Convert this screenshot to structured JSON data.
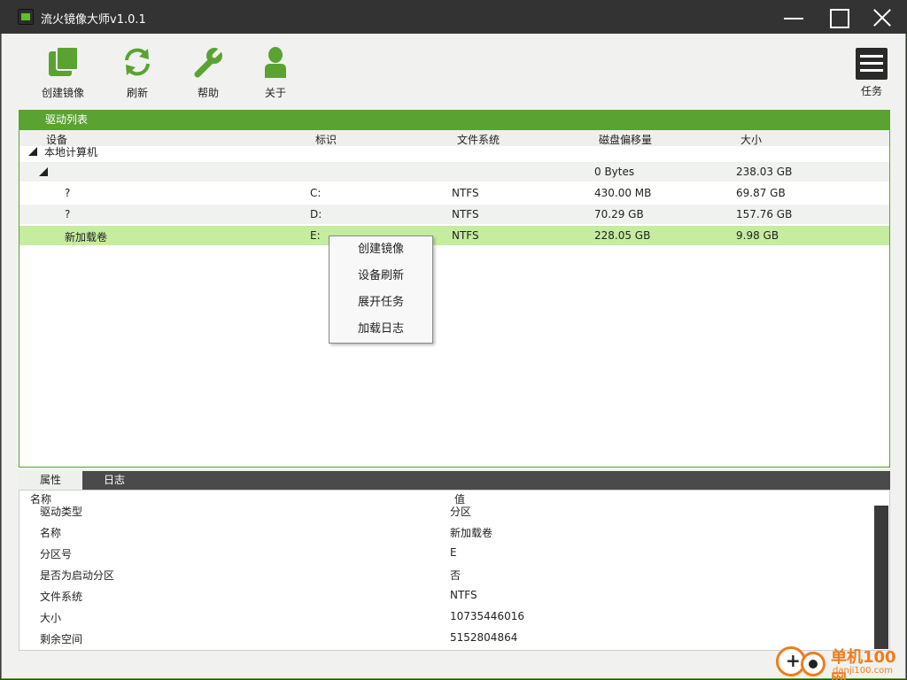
{
  "window": {
    "title": "流火镜像大师v1.0.1"
  },
  "toolbar": {
    "create_label": "创建镜像",
    "refresh_label": "刷新",
    "help_label": "帮助",
    "about_label": "关于",
    "tasks_label": "任务"
  },
  "drive_list": {
    "title": "驱动列表",
    "columns": {
      "device": "设备",
      "id": "标识",
      "filesystem": "文件系统",
      "offset": "磁盘偏移量",
      "size": "大小"
    },
    "root": "本地计算机",
    "disk": {
      "offset": "0 Bytes",
      "size": "238.03 GB"
    },
    "rows": [
      {
        "device": "?",
        "id": "C:",
        "fs": "NTFS",
        "offset": "430.00 MB",
        "size": "69.87 GB"
      },
      {
        "device": "?",
        "id": "D:",
        "fs": "NTFS",
        "offset": "70.29 GB",
        "size": "157.76 GB"
      },
      {
        "device": "新加载卷",
        "id": "E:",
        "fs": "NTFS",
        "offset": "228.05 GB",
        "size": "9.98 GB"
      }
    ]
  },
  "context_menu": {
    "items": [
      "创建镜像",
      "设备刷新",
      "展开任务",
      "加载日志"
    ]
  },
  "bottom_tabs": {
    "properties": "属性",
    "log": "日志"
  },
  "properties": {
    "columns": {
      "name": "名称",
      "value": "值"
    },
    "rows": [
      {
        "name": "驱动类型",
        "value": "分区"
      },
      {
        "name": "名称",
        "value": "新加载卷"
      },
      {
        "name": "分区号",
        "value": "E"
      },
      {
        "name": "是否为启动分区",
        "value": "否"
      },
      {
        "name": "文件系统",
        "value": "NTFS"
      },
      {
        "name": "大小",
        "value": "10735446016"
      },
      {
        "name": "剩余空间",
        "value": "5152804864"
      }
    ]
  },
  "watermark": {
    "title": "单机100网",
    "url": "danji100.com"
  },
  "colors": {
    "accent_green": "#5aa332",
    "selected_row": "#c5ec9f",
    "titlebar": "#333333",
    "watermark_orange": "#f07c18"
  }
}
